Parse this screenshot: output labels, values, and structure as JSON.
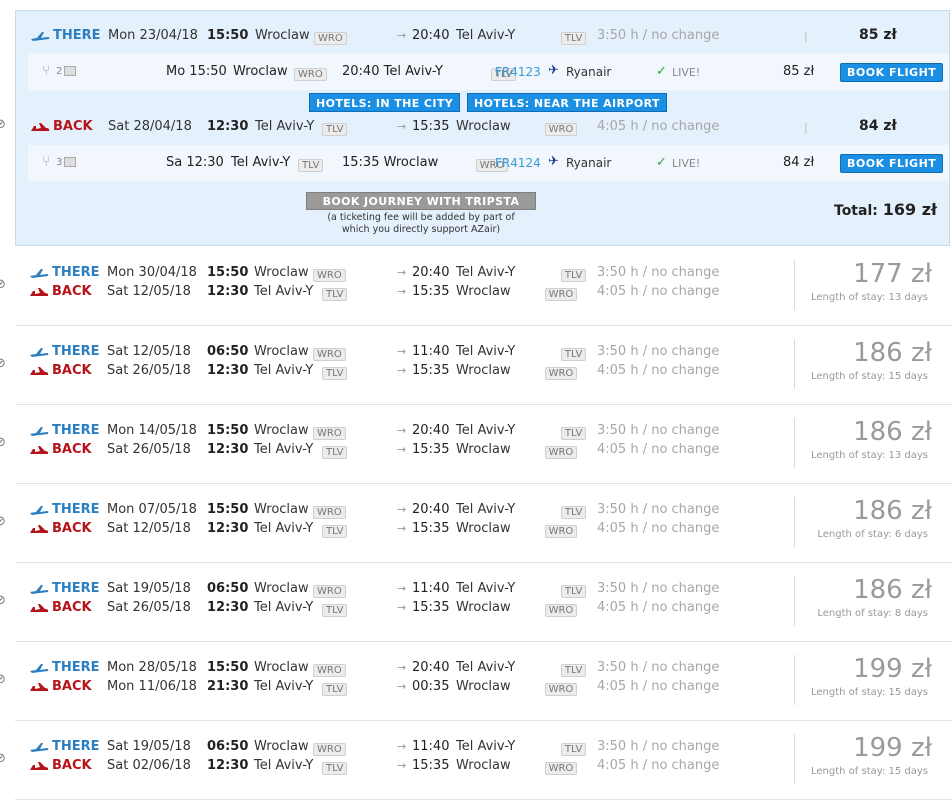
{
  "selected": {
    "there": {
      "direction": "THERE",
      "date": "Mon 23/04/18",
      "dep_time": "15:50",
      "from_city": "Wroclaw",
      "from_code": "WRO",
      "arr_time": "20:40",
      "to_city": "Tel Aviv-Y",
      "to_code": "TLV",
      "duration": "3:50 h / no change",
      "price": "85 zł",
      "detail": {
        "seats": "2",
        "day_time": "Mo 15:50",
        "from_city": "Wroclaw",
        "from_code": "WRO",
        "arr": "20:40 Tel Aviv-Y",
        "to_code": "TLV",
        "flight_no": "FR4123",
        "airline": "Ryanair",
        "live": "LIVE!",
        "price": "85 zł",
        "book": "BOOK FLIGHT"
      }
    },
    "hotels_city": "HOTELS: IN THE CITY",
    "hotels_airport": "HOTELS: NEAR THE AIRPORT",
    "back": {
      "direction": "BACK",
      "date": "Sat 28/04/18",
      "dep_time": "12:30",
      "from_city": "Tel Aviv-Y",
      "from_code": "TLV",
      "arr_time": "15:35",
      "to_city": "Wroclaw",
      "to_code": "WRO",
      "duration": "4:05 h / no change",
      "price": "84 zł",
      "detail": {
        "seats": "3",
        "day_time": "Sa 12:30",
        "from_city": "Tel Aviv-Y",
        "from_code": "TLV",
        "arr": "15:35 Wroclaw",
        "to_code": "WRO",
        "flight_no": "FR4124",
        "airline": "Ryanair",
        "live": "LIVE!",
        "price": "84 zł",
        "book": "BOOK FLIGHT"
      }
    },
    "tripsta": "BOOK JOURNEY WITH TRIPSTA",
    "fee_note_1": "(a ticketing fee will be added by part of",
    "fee_note_2": "which you directly support AZair)",
    "total_label": "Total:",
    "total_value": "169 zł"
  },
  "results": [
    {
      "there": {
        "dir": "THERE",
        "date": "Mon 30/04/18",
        "dep": "15:50",
        "from": "Wroclaw",
        "from_code": "WRO",
        "arr": "20:40",
        "to": "Tel Aviv-Y",
        "to_code": "TLV",
        "dur": "3:50 h / no change"
      },
      "back": {
        "dir": "BACK",
        "date": "Sat 12/05/18",
        "dep": "12:30",
        "from": "Tel Aviv-Y",
        "from_code": "TLV",
        "arr": "15:35",
        "to": "Wroclaw",
        "to_code": "WRO",
        "dur": "4:05 h / no change"
      },
      "price": "177 zł",
      "stay": "Length of stay: 13 days"
    },
    {
      "there": {
        "dir": "THERE",
        "date": "Sat 12/05/18",
        "dep": "06:50",
        "from": "Wroclaw",
        "from_code": "WRO",
        "arr": "11:40",
        "to": "Tel Aviv-Y",
        "to_code": "TLV",
        "dur": "3:50 h / no change"
      },
      "back": {
        "dir": "BACK",
        "date": "Sat 26/05/18",
        "dep": "12:30",
        "from": "Tel Aviv-Y",
        "from_code": "TLV",
        "arr": "15:35",
        "to": "Wroclaw",
        "to_code": "WRO",
        "dur": "4:05 h / no change"
      },
      "price": "186 zł",
      "stay": "Length of stay: 15 days"
    },
    {
      "there": {
        "dir": "THERE",
        "date": "Mon 14/05/18",
        "dep": "15:50",
        "from": "Wroclaw",
        "from_code": "WRO",
        "arr": "20:40",
        "to": "Tel Aviv-Y",
        "to_code": "TLV",
        "dur": "3:50 h / no change"
      },
      "back": {
        "dir": "BACK",
        "date": "Sat 26/05/18",
        "dep": "12:30",
        "from": "Tel Aviv-Y",
        "from_code": "TLV",
        "arr": "15:35",
        "to": "Wroclaw",
        "to_code": "WRO",
        "dur": "4:05 h / no change"
      },
      "price": "186 zł",
      "stay": "Length of stay: 13 days"
    },
    {
      "there": {
        "dir": "THERE",
        "date": "Mon 07/05/18",
        "dep": "15:50",
        "from": "Wroclaw",
        "from_code": "WRO",
        "arr": "20:40",
        "to": "Tel Aviv-Y",
        "to_code": "TLV",
        "dur": "3:50 h / no change"
      },
      "back": {
        "dir": "BACK",
        "date": "Sat 12/05/18",
        "dep": "12:30",
        "from": "Tel Aviv-Y",
        "from_code": "TLV",
        "arr": "15:35",
        "to": "Wroclaw",
        "to_code": "WRO",
        "dur": "4:05 h / no change"
      },
      "price": "186 zł",
      "stay": "Length of stay: 6 days"
    },
    {
      "there": {
        "dir": "THERE",
        "date": "Sat 19/05/18",
        "dep": "06:50",
        "from": "Wroclaw",
        "from_code": "WRO",
        "arr": "11:40",
        "to": "Tel Aviv-Y",
        "to_code": "TLV",
        "dur": "3:50 h / no change"
      },
      "back": {
        "dir": "BACK",
        "date": "Sat 26/05/18",
        "dep": "12:30",
        "from": "Tel Aviv-Y",
        "from_code": "TLV",
        "arr": "15:35",
        "to": "Wroclaw",
        "to_code": "WRO",
        "dur": "4:05 h / no change"
      },
      "price": "186 zł",
      "stay": "Length of stay: 8 days"
    },
    {
      "there": {
        "dir": "THERE",
        "date": "Mon 28/05/18",
        "dep": "15:50",
        "from": "Wroclaw",
        "from_code": "WRO",
        "arr": "20:40",
        "to": "Tel Aviv-Y",
        "to_code": "TLV",
        "dur": "3:50 h / no change"
      },
      "back": {
        "dir": "BACK",
        "date": "Mon 11/06/18",
        "dep": "21:30",
        "from": "Tel Aviv-Y",
        "from_code": "TLV",
        "arr": "00:35",
        "to": "Wroclaw",
        "to_code": "WRO",
        "dur": "4:05 h / no change"
      },
      "price": "199 zł",
      "stay": "Length of stay: 15 days"
    },
    {
      "there": {
        "dir": "THERE",
        "date": "Sat 19/05/18",
        "dep": "06:50",
        "from": "Wroclaw",
        "from_code": "WRO",
        "arr": "11:40",
        "to": "Tel Aviv-Y",
        "to_code": "TLV",
        "dur": "3:50 h / no change"
      },
      "back": {
        "dir": "BACK",
        "date": "Sat 02/06/18",
        "dep": "12:30",
        "from": "Tel Aviv-Y",
        "from_code": "TLV",
        "arr": "15:35",
        "to": "Wroclaw",
        "to_code": "WRO",
        "dur": "4:05 h / no change"
      },
      "price": "199 zł",
      "stay": "Length of stay: 15 days"
    }
  ]
}
